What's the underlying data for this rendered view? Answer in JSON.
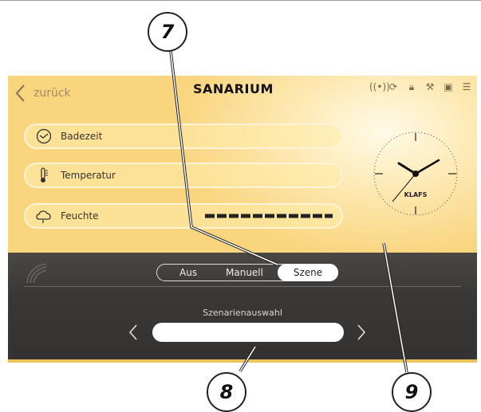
{
  "header": {
    "back_label": "zurück",
    "title": "SANARIUM"
  },
  "top_icons": [
    "wireless-icon",
    "refresh-icon",
    "lock-icon",
    "wrench-icon",
    "save-icon",
    "list-icon"
  ],
  "params": [
    {
      "label": "Badezeit",
      "icon": "clock-icon"
    },
    {
      "label": "Temperatur",
      "icon": "thermometer-icon"
    },
    {
      "label": "Feuchte",
      "icon": "cloud-icon",
      "level": 1.0
    }
  ],
  "clock": {
    "brand": "KLAFS",
    "hour": 10,
    "minute": 10,
    "second": 37
  },
  "mode": {
    "options": [
      "Aus",
      "Manuell",
      "Szene"
    ],
    "selected": "Szene"
  },
  "scenario": {
    "label": "Szenarienauswahl",
    "value": ""
  },
  "callouts": [
    "7",
    "8",
    "9"
  ],
  "colors": {
    "panel": "#f9d57e",
    "dark": "#3a3836"
  }
}
